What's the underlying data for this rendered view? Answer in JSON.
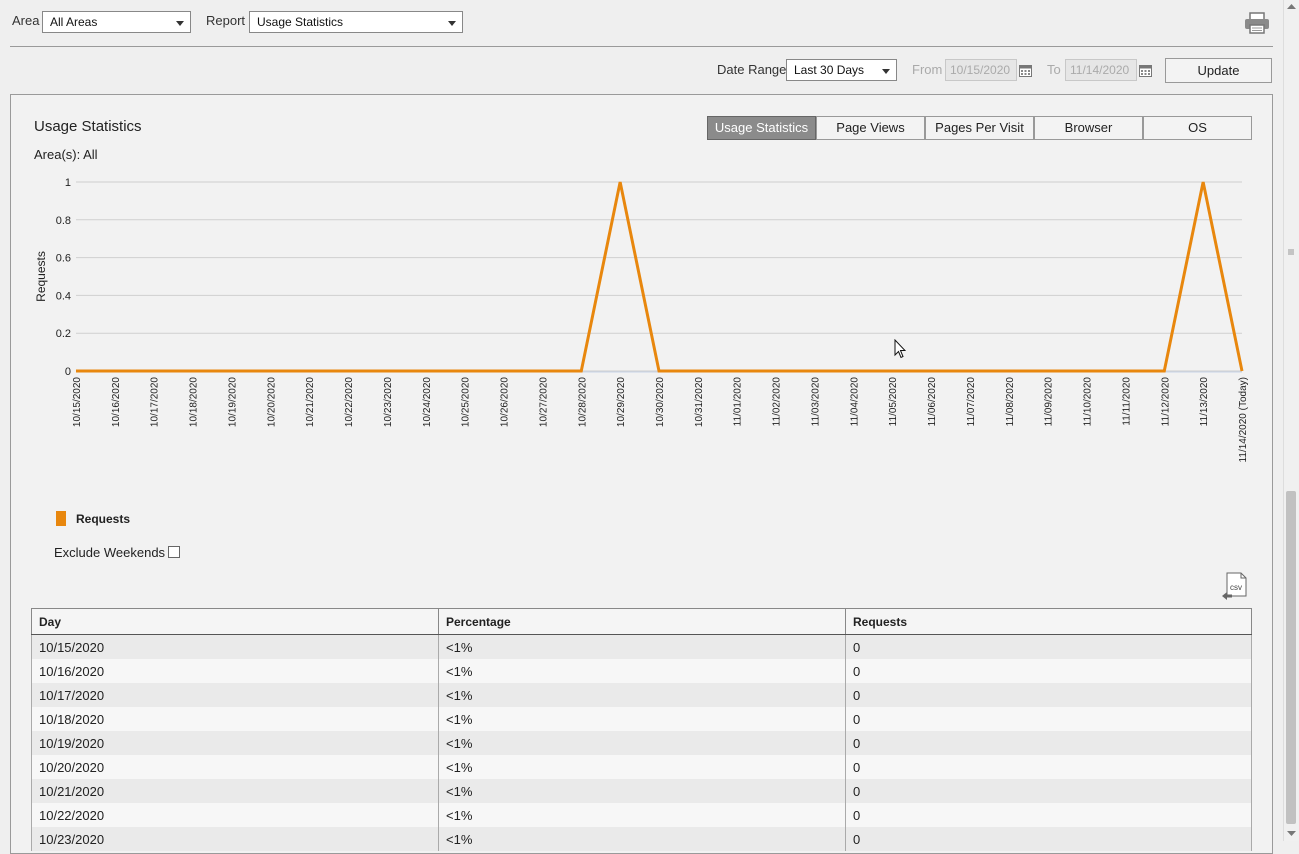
{
  "filters": {
    "area_label": "Area",
    "area_value": "All Areas",
    "report_label": "Report",
    "report_value": "Usage Statistics"
  },
  "date_range": {
    "label": "Date Range",
    "value": "Last 30 Days",
    "from_label": "From",
    "from_value": "10/15/2020",
    "to_label": "To",
    "to_value": "11/14/2020",
    "update_label": "Update"
  },
  "panel": {
    "title": "Usage Statistics",
    "areas": "Area(s): All",
    "tabs": [
      "Usage Statistics",
      "Page Views",
      "Pages Per Visit",
      "Browser",
      "OS"
    ],
    "active_tab": 0
  },
  "chart_data": {
    "type": "line",
    "ylabel": "Requests",
    "ylim": [
      0,
      1
    ],
    "yticks": [
      "1",
      "0.8",
      "0.6",
      "0.4",
      "0.2",
      "0"
    ],
    "categories": [
      "10/15/2020",
      "10/16/2020",
      "10/17/2020",
      "10/18/2020",
      "10/19/2020",
      "10/20/2020",
      "10/21/2020",
      "10/22/2020",
      "10/23/2020",
      "10/24/2020",
      "10/25/2020",
      "10/26/2020",
      "10/27/2020",
      "10/28/2020",
      "10/29/2020",
      "10/30/2020",
      "10/31/2020",
      "11/01/2020",
      "11/02/2020",
      "11/03/2020",
      "11/04/2020",
      "11/05/2020",
      "11/06/2020",
      "11/07/2020",
      "11/08/2020",
      "11/09/2020",
      "11/10/2020",
      "11/11/2020",
      "11/12/2020",
      "11/13/2020",
      "11/14/2020 (Today)"
    ],
    "series": [
      {
        "name": "Requests",
        "color": "#e8870e",
        "values": [
          0,
          0,
          0,
          0,
          0,
          0,
          0,
          0,
          0,
          0,
          0,
          0,
          0,
          0,
          1,
          0,
          0,
          0,
          0,
          0,
          0,
          0,
          0,
          0,
          0,
          0,
          0,
          0,
          0,
          1,
          0
        ]
      }
    ],
    "grid": true,
    "legend": "bottom-left"
  },
  "legend_label": "Requests",
  "exclude_weekends_label": "Exclude Weekends",
  "table": {
    "headers": [
      "Day",
      "Percentage",
      "Requests"
    ],
    "rows": [
      [
        "10/15/2020",
        "<1%",
        "0"
      ],
      [
        "10/16/2020",
        "<1%",
        "0"
      ],
      [
        "10/17/2020",
        "<1%",
        "0"
      ],
      [
        "10/18/2020",
        "<1%",
        "0"
      ],
      [
        "10/19/2020",
        "<1%",
        "0"
      ],
      [
        "10/20/2020",
        "<1%",
        "0"
      ],
      [
        "10/21/2020",
        "<1%",
        "0"
      ],
      [
        "10/22/2020",
        "<1%",
        "0"
      ],
      [
        "10/23/2020",
        "<1%",
        "0"
      ]
    ]
  }
}
